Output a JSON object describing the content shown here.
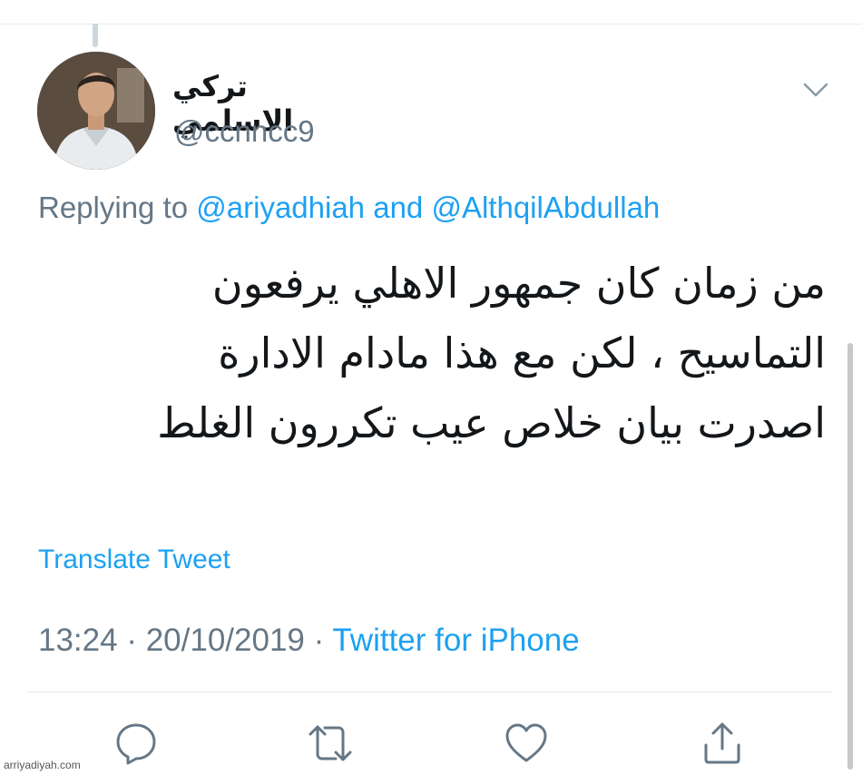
{
  "tweet": {
    "display_name": "تركي الاسلمي",
    "handle": "@ccnncc9",
    "reply": {
      "prefix": "Replying to ",
      "mention_1": "@ariyadhiah",
      "conjunction": " and ",
      "mention_2": "@AlthqilAbdullah"
    },
    "text_lines": [
      "من زمان كان جمهور الاهلي يرفعون",
      "التماسيح ، لكن مع هذا مادام الادارة",
      "اصدرت بيان خلاص عيب تكررون الغلط"
    ],
    "translate_label": "Translate Tweet",
    "time": "13:24",
    "separator": " · ",
    "date": "20/10/2019",
    "source": "Twitter for iPhone"
  },
  "actions": {
    "reply_icon": "reply-icon",
    "retweet_icon": "retweet-icon",
    "like_icon": "like-icon",
    "share_icon": "share-icon"
  },
  "watermark": "arriyadiyah.com",
  "colors": {
    "link": "#1da1f2",
    "secondary_text": "#657786",
    "primary_text": "#14171a",
    "divider": "#e6ecf0"
  }
}
